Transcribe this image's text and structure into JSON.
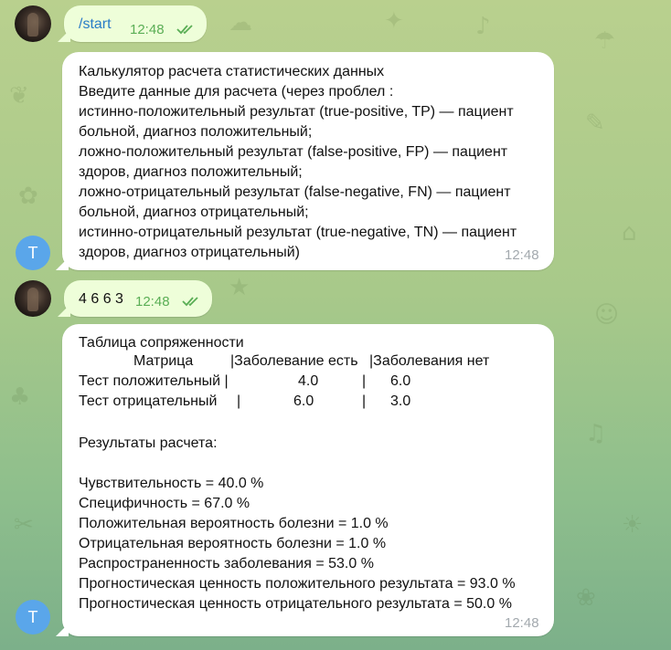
{
  "messages": [
    {
      "sender": "user",
      "text": "/start",
      "time": "12:48",
      "status": "read"
    },
    {
      "sender": "bot",
      "avatar_letter": "T",
      "lines": [
        "Калькулятор расчета статистических данных",
        "Введите данные для расчета (через проблел :",
        "истинно-положительный результат (true-positive, TP) — пациент",
        "больной, диагноз положительный;",
        "ложно-положительный результат (false-positive, FP) — пациент",
        "здоров, диагноз положительный;",
        "ложно-отрицательный результат (false-negative, FN) — пациент",
        "больной, диагноз отрицательный;",
        "истинно-отрицательный результат (true-negative, TN) — пациент",
        "здоров, диагноз отрицательный)"
      ],
      "time": "12:48"
    },
    {
      "sender": "user",
      "text": "4 6 6 3",
      "time": "12:48",
      "status": "read"
    },
    {
      "sender": "bot",
      "avatar_letter": "T",
      "table": {
        "title": "Таблица сопряженности",
        "header": [
          "Матрица",
          "|Заболевание есть",
          "|Заболевания нет"
        ],
        "rows": [
          [
            "Тест положительный |",
            "4.0",
            "|",
            "6.0"
          ],
          [
            "Тест отрицательный",
            "|",
            "6.0",
            "|",
            "3.0"
          ]
        ]
      },
      "results_title": "Результаты расчета:",
      "results": [
        "Чувствительность = 40.0 %",
        "Специфичность = 67.0 %",
        "Положительная вероятность болезни = 1.0 %",
        "Отрицательная вероятность болезни = 1.0 %",
        "Распространенность заболевания = 53.0 %",
        "Прогностическая ценность положительного результата = 93.0 %",
        "Прогностическая ценность отрицательного результата = 50.0 %"
      ],
      "time": "12:48"
    }
  ],
  "colors": {
    "outgoing_bubble": "#eefed9",
    "incoming_bubble": "#ffffff",
    "command_link": "#2a7cc7",
    "read_ticks": "#5aae55",
    "bot_avatar": "#5aa6ea"
  }
}
